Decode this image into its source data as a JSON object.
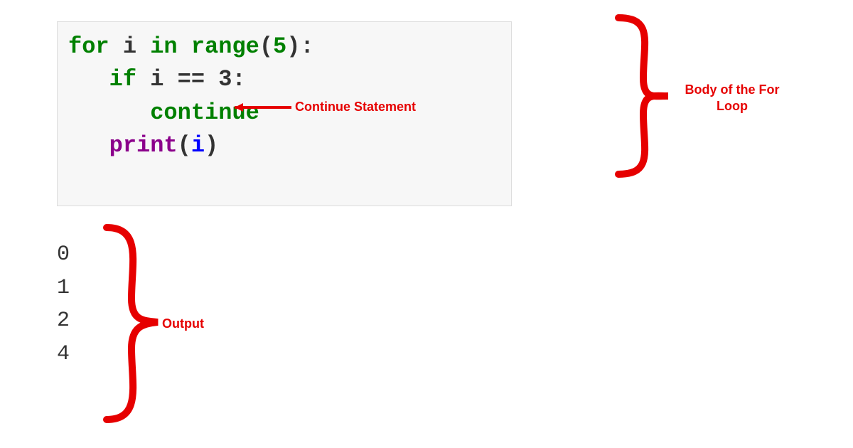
{
  "code": {
    "line1_for": "for",
    "line1_var": " i ",
    "line1_in": "in",
    "line1_range": " range",
    "line1_open": "(",
    "line1_num": "5",
    "line1_close": "):",
    "line2_indent": "   ",
    "line2_if": "if",
    "line2_cond": " i == 3:",
    "line3_indent": "      ",
    "line3_cont": "continue",
    "line4_indent": "   ",
    "line4_print": "print",
    "line4_open": "(",
    "line4_arg": "i",
    "line4_close": ")"
  },
  "annotations": {
    "continue_label": "Continue Statement",
    "body_label": "Body of the For Loop",
    "output_label": "Output"
  },
  "output": {
    "l0": "0",
    "l1": "1",
    "l2": "2",
    "l3": "4"
  }
}
